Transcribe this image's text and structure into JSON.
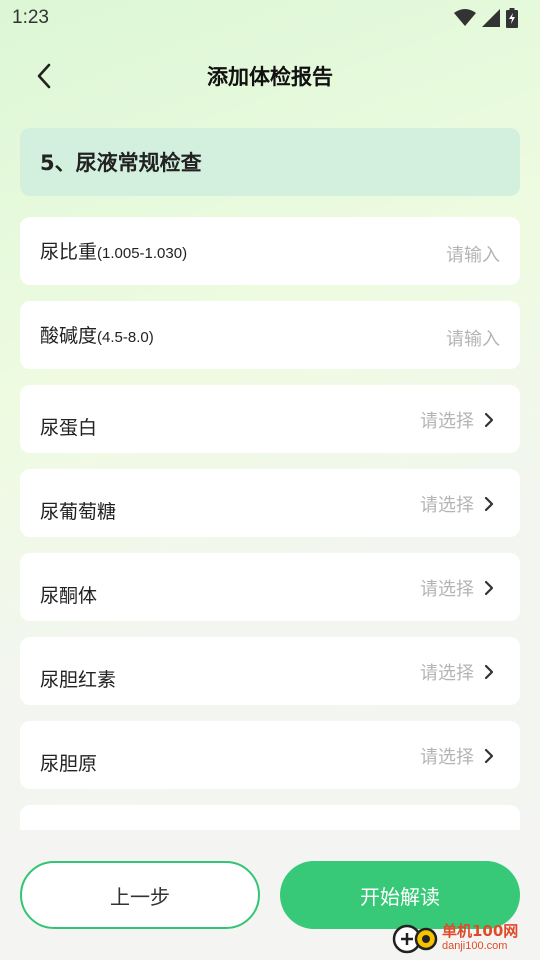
{
  "status_bar": {
    "time": "1:23",
    "icons": [
      "wifi-icon",
      "signal-icon",
      "battery-charging-icon"
    ]
  },
  "header": {
    "back_icon": "chevron-left-icon",
    "title": "添加体检报告"
  },
  "section": {
    "title": "5、尿液常规检查"
  },
  "form": {
    "input_rows": [
      {
        "label": "尿比重",
        "range": "(1.005-1.030)",
        "value": "",
        "placeholder": "请输入"
      },
      {
        "label": "酸碱度",
        "range": "(4.5-8.0)",
        "value": "",
        "placeholder": "请输入"
      }
    ],
    "select_rows": [
      {
        "label": "尿蛋白",
        "placeholder": "请选择"
      },
      {
        "label": "尿葡萄糖",
        "placeholder": "请选择"
      },
      {
        "label": "尿酮体",
        "placeholder": "请选择"
      },
      {
        "label": "尿胆红素",
        "placeholder": "请选择"
      },
      {
        "label": "尿胆原",
        "placeholder": "请选择"
      }
    ],
    "chevron_icon": "chevron-right-icon"
  },
  "footer": {
    "prev_label": "上一步",
    "start_label": "开始解读"
  },
  "watermark": {
    "name": "单机100网",
    "url": "danji100.com"
  },
  "colors": {
    "accent": "#38c978",
    "section_bg": "#d3f0de",
    "placeholder": "#b4b4b4"
  }
}
